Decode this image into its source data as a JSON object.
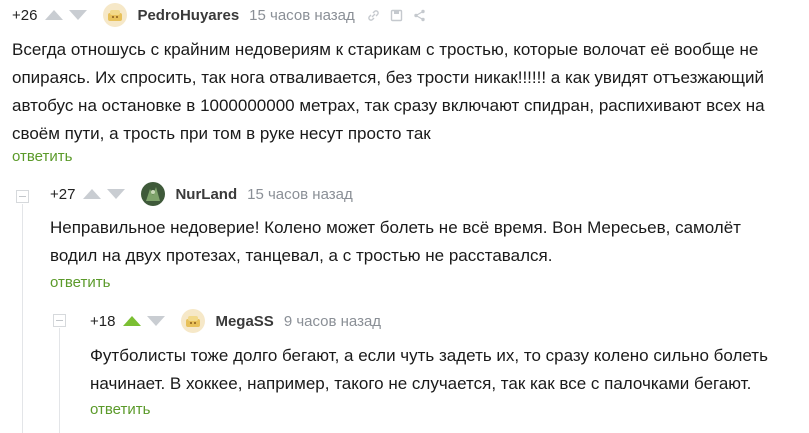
{
  "comments": [
    {
      "rating": "+26",
      "username": "PedroHuyares",
      "time": "15 часов назад",
      "text": "Всегда отношусь с крайним недовериям к старикам с тростью, которые волочат её вообще не опираясь. Их спросить, так нога отваливается, без трости никак!!!!!! а как увидят отъезжающий автобус на остановке в 1000000000 метрах, так сразу включают спидран, распихивают всех на своём пути, а трость при том в руке несут просто так",
      "reply_label": "ответить",
      "upvoted": false
    },
    {
      "rating": "+27",
      "username": "NurLand",
      "time": "15 часов назад",
      "text": "Неправильное недоверие! Колено может болеть не всё время. Вон Мересьев, самолёт водил на двух протезах, танцевал, а с тростью не расставался.",
      "reply_label": "ответить",
      "upvoted": false
    },
    {
      "rating": "+18",
      "username": "MegaSS",
      "time": "9 часов назад",
      "text": "Футболисты тоже долго бегают, а если чуть задеть их, то сразу колено сильно болеть начинает. В хоккее, например, такого не случается, так как все с палочками бегают.",
      "reply_label": "ответить",
      "upvoted": true
    }
  ],
  "colors": {
    "accent_green": "#5b9a2a",
    "upvote_active": "#7bbf33",
    "vote_inactive": "#c9cdd2",
    "muted": "#8a8f96"
  },
  "icons": [
    "link-icon",
    "save-icon",
    "share-icon",
    "collapse-icon"
  ]
}
